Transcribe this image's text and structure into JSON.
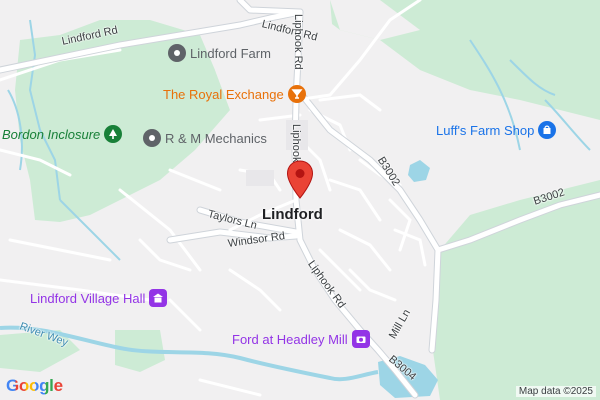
{
  "map": {
    "town_label": "Lindford",
    "roads": {
      "lindford_rd_west": "Lindford Rd",
      "lindford_rd_north": "Lindford Rd",
      "liphook_rd_north": "Liphook Rd",
      "liphook_rd_south": "Liphook Rd",
      "taylors_ln": "Taylors Ln",
      "windsor_rd": "Windsor Rd",
      "b3002_upper": "B3002",
      "b3002_right": "B3002",
      "mill_ln": "Mill Ln",
      "b3004": "B3004",
      "river_wey": "River Wey"
    },
    "pois": {
      "lindford_farm": {
        "label": "Lindford Farm",
        "icon": "pin-icon",
        "color": "#5f6368"
      },
      "royal_exchange": {
        "label": "The Royal Exchange",
        "icon": "cocktail-icon",
        "color": "#e8710a"
      },
      "bordon_inclosure": {
        "label": "Bordon Inclosure",
        "icon": "tree-icon",
        "color": "#188038"
      },
      "rm_mechanics": {
        "label": "R & M Mechanics",
        "icon": "pin-icon",
        "color": "#5f6368"
      },
      "luffs_farm_shop": {
        "label": "Luff's Farm Shop",
        "icon": "shopping-bag-icon",
        "color": "#1a73e8"
      },
      "village_hall": {
        "label": "Lindford Village Hall",
        "icon": "building-icon",
        "color": "#9334e6"
      },
      "ford_headley_mill": {
        "label": "Ford at Headley Mill",
        "icon": "camera-icon",
        "color": "#9334e6"
      }
    },
    "marker": {
      "name": "location-marker",
      "color": "#ea4335"
    },
    "colors": {
      "park": "#cdebd5",
      "water": "#9dd5e6",
      "land": "#f1f0f1",
      "road": "#ffffff",
      "road_casing": "#cfd4da"
    }
  },
  "footer": {
    "logo": "Google",
    "attribution": "Map data ©2025"
  }
}
